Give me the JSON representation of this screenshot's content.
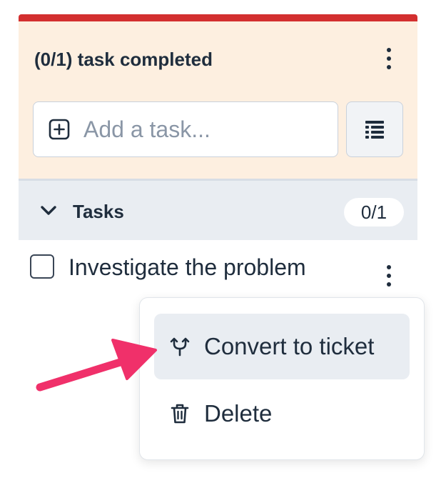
{
  "header": {
    "title": "(0/1) task completed",
    "accent_color": "#d32f2f",
    "background_color": "#fdefe0"
  },
  "add_task": {
    "placeholder": "Add a task...",
    "value": ""
  },
  "section": {
    "title": "Tasks",
    "count": "0/1",
    "expanded": true
  },
  "tasks": [
    {
      "label": "Investigate the problem",
      "completed": false
    }
  ],
  "menu": {
    "items": [
      {
        "label": "Convert to ticket",
        "icon": "fork-icon",
        "highlighted": true
      },
      {
        "label": "Delete",
        "icon": "trash-icon",
        "highlighted": false
      }
    ]
  },
  "annotation": {
    "icon": "arrow-icon",
    "color": "#f0306a"
  }
}
